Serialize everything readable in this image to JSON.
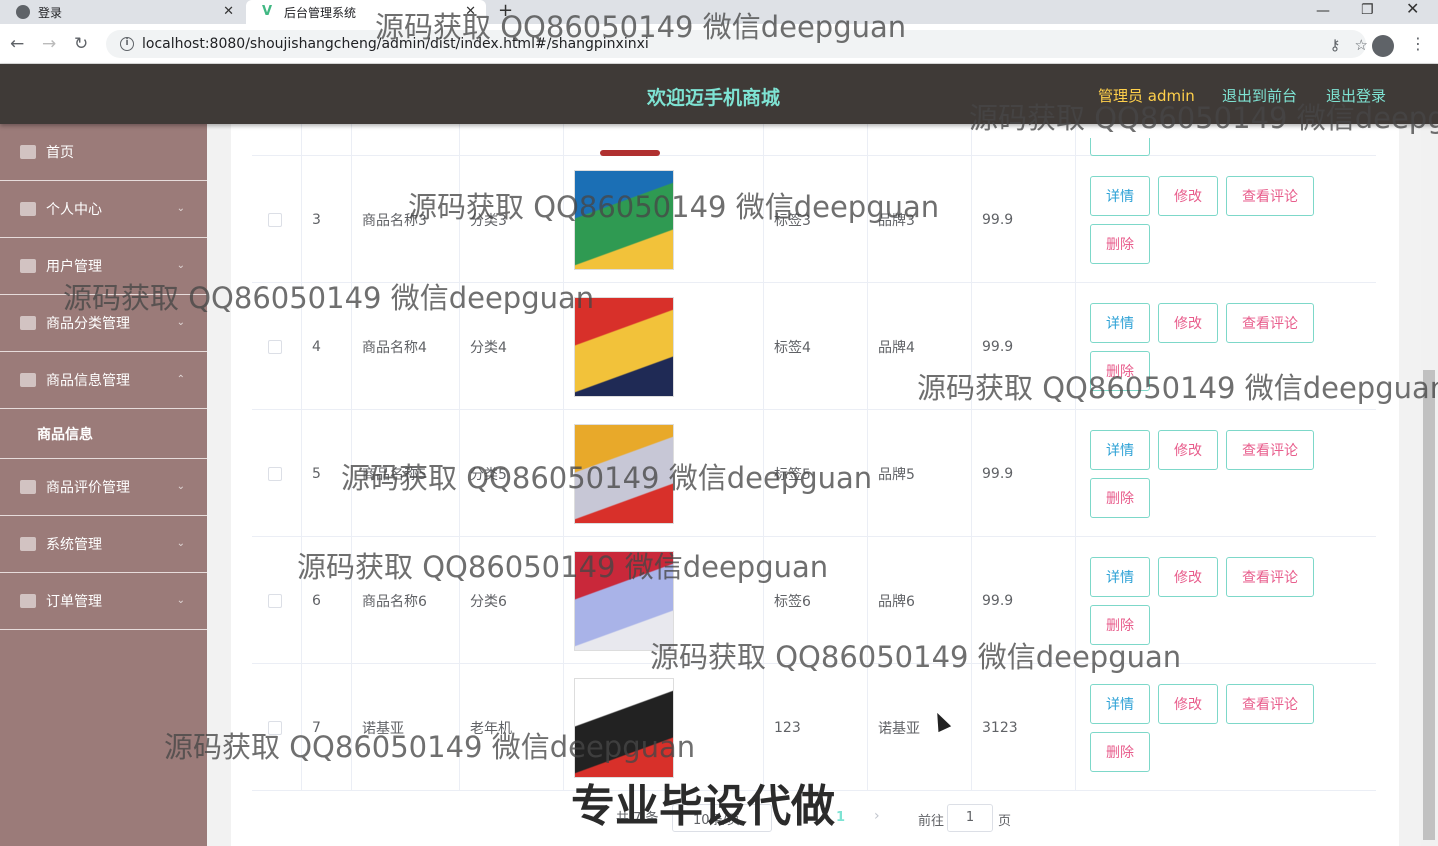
{
  "browser": {
    "tabs": [
      {
        "title": "登录",
        "icon": "globe-icon"
      },
      {
        "title": "后台管理系统",
        "icon": "vue-icon"
      }
    ],
    "url": "localhost:8080/shoujishangcheng/admin/dist/index.html#/shangpinxinxi"
  },
  "header": {
    "title": "欢迎迈手机商城",
    "user": "管理员 admin",
    "link_front": "退出到前台",
    "link_logout": "退出登录"
  },
  "sidebar": {
    "items": [
      {
        "label": "首页",
        "icon": "home-icon"
      },
      {
        "label": "个人中心",
        "icon": "user-icon"
      },
      {
        "label": "用户管理",
        "icon": "users-icon"
      },
      {
        "label": "商品分类管理",
        "icon": "grid-icon"
      },
      {
        "label": "商品信息管理",
        "icon": "chart-icon"
      },
      {
        "label": "商品评价管理",
        "icon": "comment-icon"
      },
      {
        "label": "系统管理",
        "icon": "settings-icon"
      },
      {
        "label": "订单管理",
        "icon": "order-icon"
      }
    ],
    "sub_active": "商品信息"
  },
  "table": {
    "rows": [
      {
        "id": "3",
        "name": "商品名称3",
        "category": "分类3",
        "tag": "标签3",
        "brand": "品牌3",
        "price": "99.9",
        "img_colors": [
          "#1b6fb5",
          "#2f9a52",
          "#f2c23a"
        ]
      },
      {
        "id": "4",
        "name": "商品名称4",
        "category": "分类4",
        "tag": "标签4",
        "brand": "品牌4",
        "price": "99.9",
        "img_colors": [
          "#d8302a",
          "#f2c23a",
          "#1f2a55"
        ]
      },
      {
        "id": "5",
        "name": "商品名称5",
        "category": "分类5",
        "tag": "标签5",
        "brand": "品牌5",
        "price": "99.9",
        "img_colors": [
          "#e8a92a",
          "#c7c7d6",
          "#d8302a"
        ]
      },
      {
        "id": "6",
        "name": "商品名称6",
        "category": "分类6",
        "tag": "标签6",
        "brand": "品牌6",
        "price": "99.9",
        "img_colors": [
          "#c9283a",
          "#a9b3e8",
          "#e8e8ee"
        ]
      },
      {
        "id": "7",
        "name": "诺基亚",
        "category": "老年机",
        "tag": "123",
        "brand": "诺基亚",
        "price": "3123",
        "img_colors": [
          "#ffffff",
          "#222222",
          "#d8302a"
        ]
      }
    ],
    "buttons": {
      "detail": "详情",
      "edit": "修改",
      "review": "查看评论",
      "delete": "删除"
    }
  },
  "pagination": {
    "total": "共 7 条",
    "page_size": "10条/页",
    "current": "1",
    "goto_label": "前往",
    "goto_value": "1",
    "page_suffix": "页"
  },
  "watermark": {
    "text": "源码获取 QQ86050149 微信deepguan",
    "big": "专业毕设代做"
  },
  "colors": {
    "header_bg": "#3f3a37",
    "sidebar_bg": "#9b7b79",
    "accent": "#7ee3d3",
    "user": "#ffd04b"
  }
}
